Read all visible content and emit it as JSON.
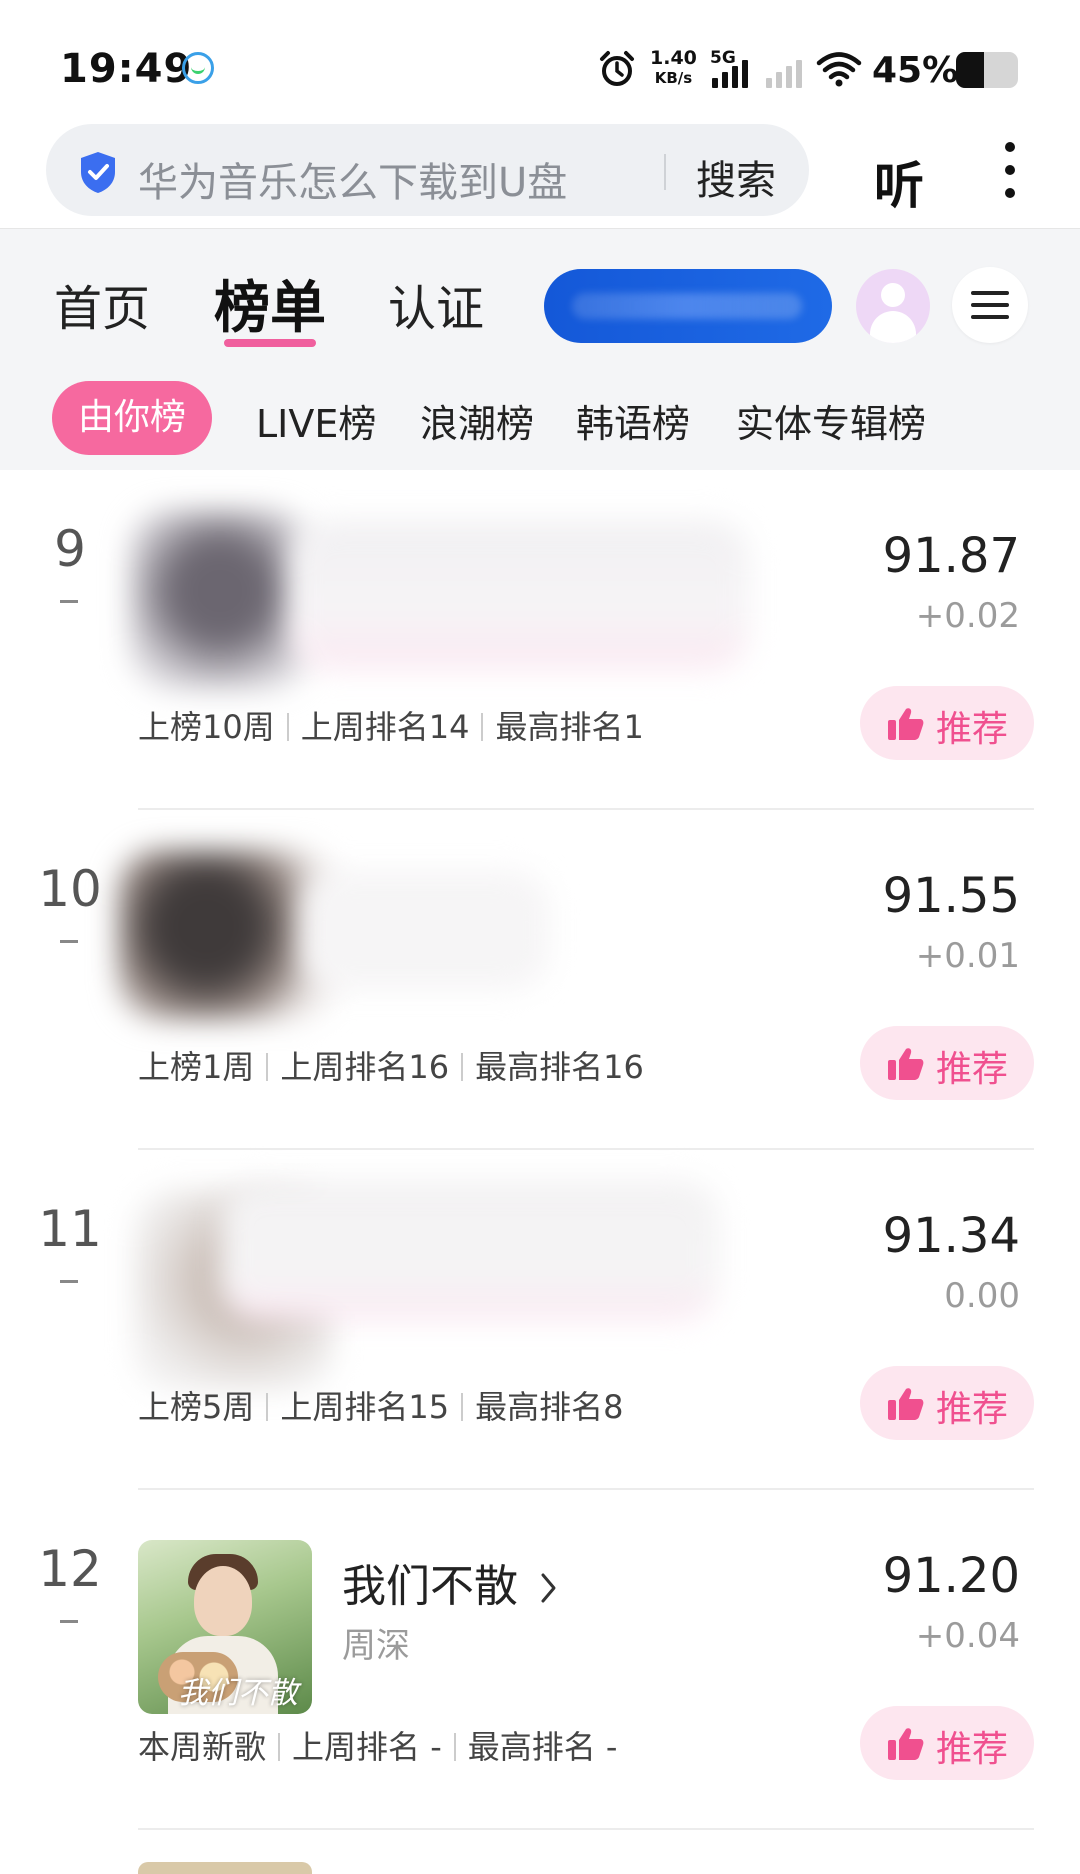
{
  "status_bar": {
    "time": "19:49",
    "net_speed_value": "1.40",
    "net_speed_unit": "KB/s",
    "network_type": "5G",
    "battery_percent": "45%",
    "battery_level": 0.45
  },
  "search": {
    "query": "华为音乐怎么下载到U盘",
    "button_label": "搜索",
    "listen_label": "听"
  },
  "nav": {
    "tabs": [
      {
        "label": "首页"
      },
      {
        "label": "榜单"
      },
      {
        "label": "认证"
      }
    ],
    "active_tab": "榜单"
  },
  "subtabs": [
    {
      "label": "由你榜"
    },
    {
      "label": "LIVE榜"
    },
    {
      "label": "浪潮榜"
    },
    {
      "label": "韩语榜"
    },
    {
      "label": "实体专辑榜"
    }
  ],
  "chart": {
    "entries": [
      {
        "rank": "9",
        "title": "",
        "artist": "",
        "score": "91.87",
        "delta": "+0.02",
        "weeks": "上榜10周",
        "last_rank": "上周排名14",
        "peak": "最高排名1",
        "recommend": "推荐"
      },
      {
        "rank": "10",
        "title": "",
        "artist": "",
        "score": "91.55",
        "delta": "+0.01",
        "weeks": "上榜1周",
        "last_rank": "上周排名16",
        "peak": "最高排名16",
        "recommend": "推荐"
      },
      {
        "rank": "11",
        "title": "",
        "artist": "",
        "score": "91.34",
        "delta": "0.00",
        "weeks": "上榜5周",
        "last_rank": "上周排名15",
        "peak": "最高排名8",
        "recommend": "推荐"
      },
      {
        "rank": "12",
        "title": "我们不散",
        "artist": "周深",
        "cover_text": "我们不散",
        "score": "91.20",
        "delta": "+0.04",
        "weeks": "本周新歌",
        "last_rank": "上周排名 -",
        "peak": "最高排名 -",
        "recommend": "推荐"
      }
    ]
  },
  "colors": {
    "accent_pink": "#f6699f",
    "recommend_bg": "#fde6ef",
    "promo_blue": "#1458d8",
    "shield_blue": "#3b6ef0"
  },
  "icons": [
    "message-icon",
    "alarm-icon",
    "signal-icon",
    "wifi-icon",
    "battery-icon",
    "shield-icon",
    "more-icon",
    "avatar-icon",
    "menu-icon",
    "thumbs-up-icon",
    "chevron-right-icon"
  ]
}
